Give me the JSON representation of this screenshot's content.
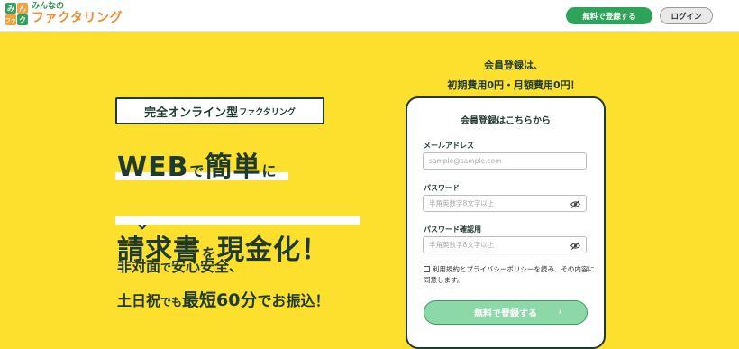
{
  "header": {
    "logo_cells": [
      "み",
      "ん",
      "ファ",
      "ク"
    ],
    "logo_sub": "みんなの",
    "logo_main": "ファクタリング",
    "register_button": "無料で登録する",
    "login_button": "ログイン"
  },
  "hero": {
    "tagline_strong": "完全オンライン型",
    "tagline_small": "ファクタリング",
    "headline1": {
      "a": "WEB",
      "b": "で",
      "c": "簡単",
      "d": "に"
    },
    "headline2": {
      "a": "請求書",
      "b": "を",
      "c": "現金化！"
    },
    "sub1": {
      "a": "非対面",
      "b": "で",
      "c": "安心安全、"
    },
    "sub2": {
      "a": "土日祝",
      "b": "でも",
      "c": "最短60分",
      "d": "でお振込！"
    }
  },
  "promo": {
    "line1": "会員登録は、",
    "line2": "初期費用0円・月額費用0円！"
  },
  "form": {
    "title": "会員登録はこちらから",
    "email_label": "メールアドレス",
    "email_placeholder": "sample@sample.com",
    "password_label": "パスワード",
    "password_placeholder": "半角英数字8文字以上",
    "password_confirm_label": "パスワード確認用",
    "password_confirm_placeholder": "半角英数字8文字以上",
    "agree_text": "利用規約とプライバシーポリシーを読み、その内容に同意します。",
    "submit_label": "無料で登録する",
    "submit_arrow": "›"
  }
}
